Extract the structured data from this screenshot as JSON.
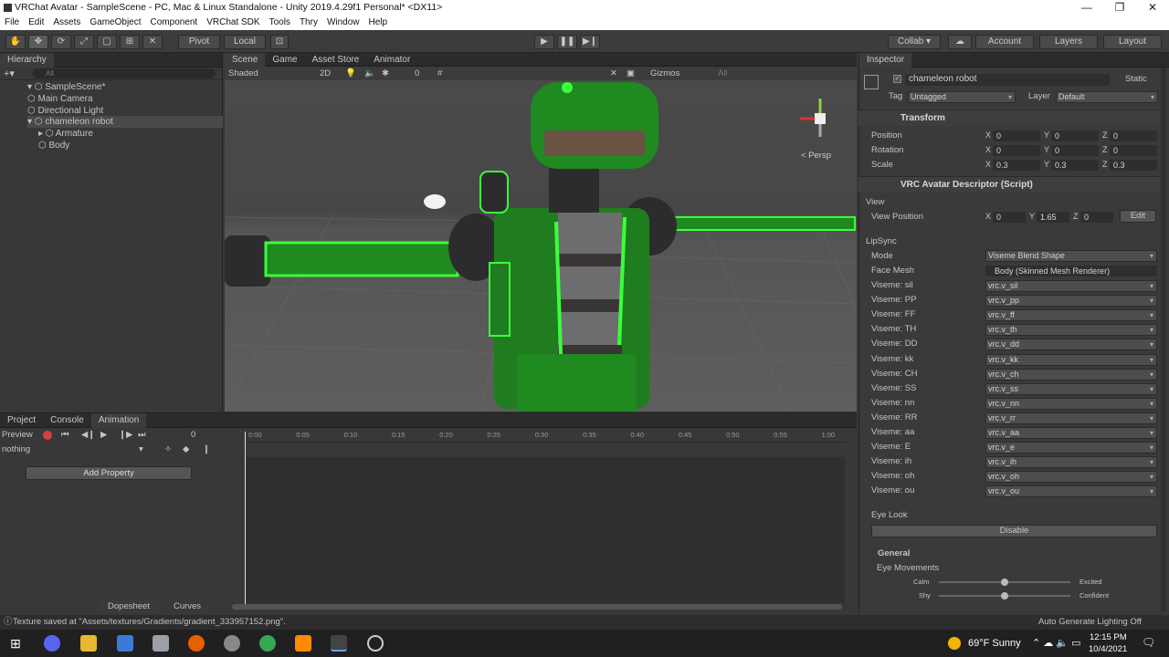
{
  "window": {
    "title": "VRChat Avatar - SampleScene - PC, Mac & Linux Standalone - Unity 2019.4.29f1 Personal* <DX11>",
    "minimize": "—",
    "maximize": "❐",
    "close": "✕"
  },
  "menu": [
    "File",
    "Edit",
    "Assets",
    "GameObject",
    "Component",
    "VRChat SDK",
    "Tools",
    "Thry",
    "Window",
    "Help"
  ],
  "toolbar": {
    "pivot": "Pivot",
    "local": "Local",
    "collab": "Collab ▾",
    "account": "Account",
    "layers": "Layers",
    "layout": "Layout"
  },
  "hierarchy": {
    "title": "Hierarchy",
    "search": "All",
    "items": [
      "SampleScene*",
      "Main Camera",
      "Directional Light",
      "chameleon robot",
      "Armature",
      "Body"
    ]
  },
  "scene": {
    "tabs": [
      "Scene",
      "Game",
      "Asset Store",
      "Animator"
    ],
    "shading": "Shaded",
    "mode2d": "2D",
    "gizmos": "Gizmos",
    "search": "All",
    "hidden": "0",
    "persp": "< Persp"
  },
  "inspector": {
    "title": "Inspector",
    "object_name": "chameleon robot",
    "static": "Static",
    "tag_label": "Tag",
    "tag": "Untagged",
    "layer_label": "Layer",
    "layer": "Default",
    "transform": {
      "title": "Transform",
      "position_label": "Position",
      "rotation_label": "Rotation",
      "scale_label": "Scale",
      "position": [
        "0",
        "0",
        "0"
      ],
      "rotation": [
        "0",
        "0",
        "0"
      ],
      "scale": [
        "0.3",
        "0.3",
        "0.3"
      ]
    },
    "descriptor": {
      "title": "VRC Avatar Descriptor (Script)",
      "view_label": "View",
      "view_position_label": "View Position",
      "view_position": [
        "0",
        "1.65",
        "0"
      ],
      "edit": "Edit",
      "lipsync": "LipSync",
      "mode_label": "Mode",
      "mode": "Viseme Blend Shape",
      "face_mesh_label": "Face Mesh",
      "face_mesh": "Body (Skinned Mesh Renderer)",
      "visemes": [
        {
          "label": "Viseme: sil",
          "value": "vrc.v_sil"
        },
        {
          "label": "Viseme: PP",
          "value": "vrc.v_pp"
        },
        {
          "label": "Viseme: FF",
          "value": "vrc.v_ff"
        },
        {
          "label": "Viseme: TH",
          "value": "vrc.v_th"
        },
        {
          "label": "Viseme: DD",
          "value": "vrc.v_dd"
        },
        {
          "label": "Viseme: kk",
          "value": "vrc.v_kk"
        },
        {
          "label": "Viseme: CH",
          "value": "vrc.v_ch"
        },
        {
          "label": "Viseme: SS",
          "value": "vrc.v_ss"
        },
        {
          "label": "Viseme: nn",
          "value": "vrc.v_nn"
        },
        {
          "label": "Viseme: RR",
          "value": "vrc.v_rr"
        },
        {
          "label": "Viseme: aa",
          "value": "vrc.v_aa"
        },
        {
          "label": "Viseme: E",
          "value": "vrc.v_e"
        },
        {
          "label": "Viseme: ih",
          "value": "vrc.v_ih"
        },
        {
          "label": "Viseme: oh",
          "value": "vrc.v_oh"
        },
        {
          "label": "Viseme: ou",
          "value": "vrc.v_ou"
        }
      ],
      "eye_look": "Eye Look",
      "disable": "Disable",
      "general": "General",
      "eye_movements": "Eye Movements",
      "calm": "Calm",
      "excited": "Excited",
      "shy": "Shy",
      "confident": "Confident",
      "calm_level": 0.5,
      "shy_level": 0.5
    }
  },
  "bottom": {
    "tabs": [
      "Project",
      "Console",
      "Animation"
    ],
    "preview": "Preview",
    "frame": "0",
    "clip": "nothing",
    "add_property": "Add Property",
    "dopesheet": "Dopesheet",
    "curves": "Curves",
    "times": [
      "0:00",
      "0:05",
      "0:10",
      "0:15",
      "0:20",
      "0:25",
      "0:30",
      "0:35",
      "0:40",
      "0:45",
      "0:50",
      "0:55",
      "1:00"
    ]
  },
  "status": {
    "message": "Texture saved at \"Assets/textures/Gradients/gradient_333957152.png\".",
    "lighting": "Auto Generate Lighting Off"
  },
  "taskbar": {
    "weather": "69°F  Sunny",
    "time": "12:15 PM",
    "date": "10/4/2021"
  }
}
